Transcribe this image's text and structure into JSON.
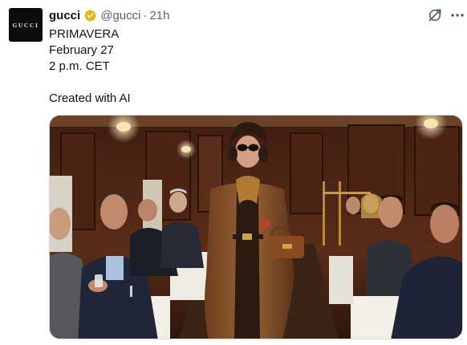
{
  "avatar": {
    "text": "GUCCI"
  },
  "user": {
    "name": "gucci",
    "handle": "@gucci",
    "separator": "·",
    "time": "21h"
  },
  "tweet": {
    "lines": [
      "PRIMAVERA",
      "February 27",
      "2 p.m. CET"
    ],
    "caption": "Created with AI"
  },
  "icons": {
    "verified": "verified-gold-badge-icon",
    "grok": "grok-icon",
    "more": "more-dots-icon"
  },
  "colors": {
    "verified_gold": "#e2b719",
    "text_primary": "#0f1419",
    "text_secondary": "#536471",
    "border": "#cfd9de"
  }
}
